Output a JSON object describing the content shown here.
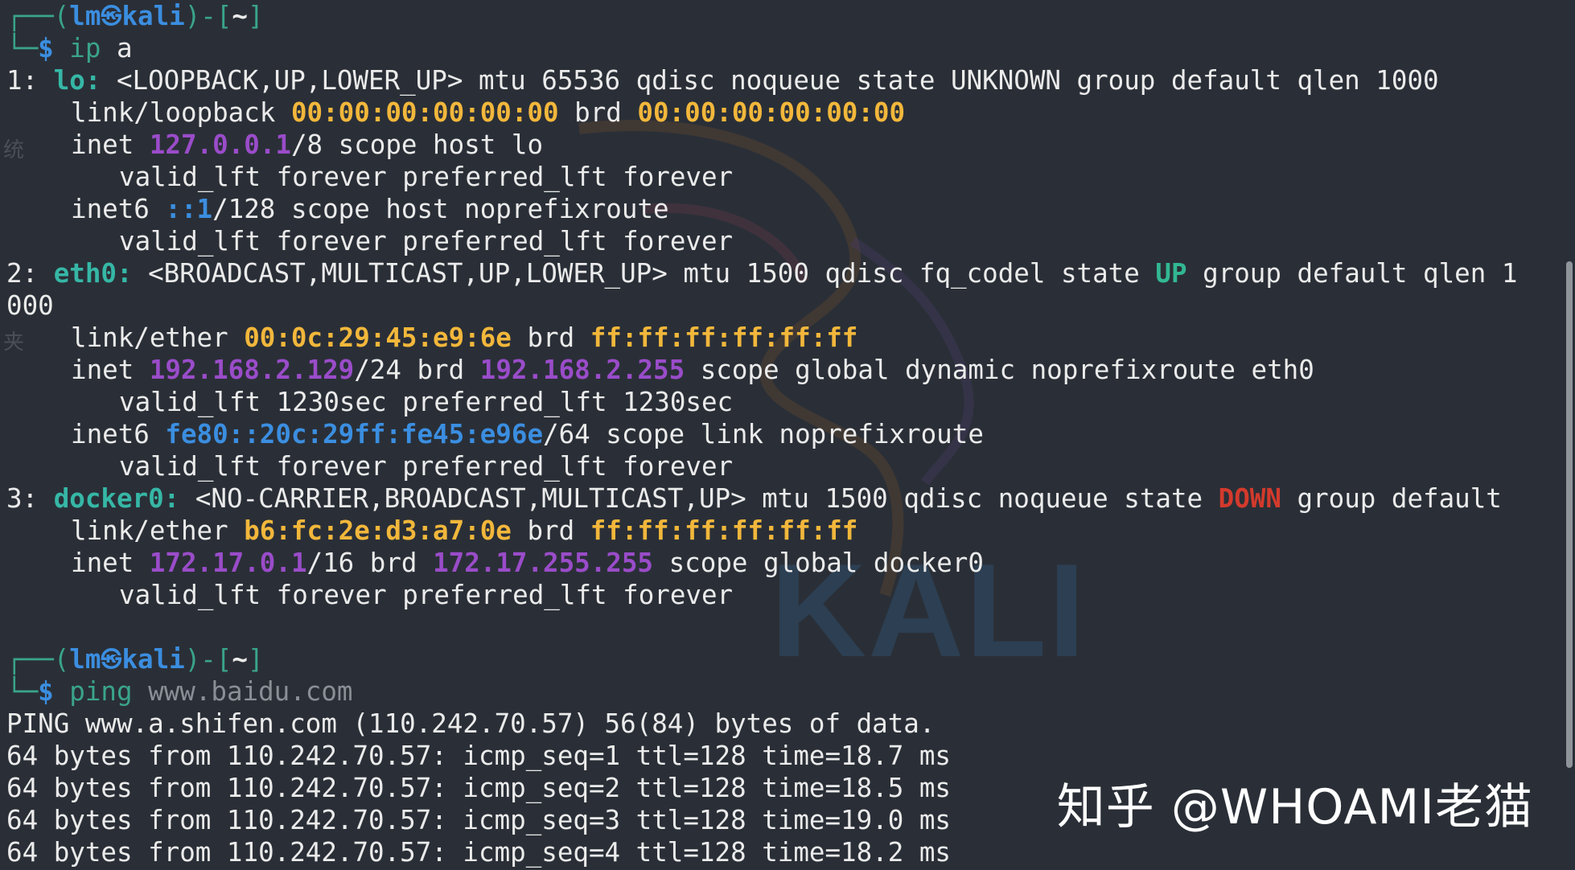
{
  "background_text": "KALI",
  "prompt1": {
    "corner_top": "┌──(",
    "user": "lm",
    "host": "kali",
    "mid": ")-[",
    "cwd": "~",
    "end": "]",
    "corner_bottom": "└─",
    "dollar": "$ ",
    "cmd": "ip",
    "args": " a"
  },
  "iface1": {
    "num": "1: ",
    "name": "lo:",
    "flags": " <LOOPBACK,UP,LOWER_UP> mtu 65536 qdisc noqueue state UNKNOWN group default qlen 1000",
    "link_label": "link/loopback ",
    "mac": "00:00:00:00:00:00",
    "brd_label": " brd ",
    "brd": "00:00:00:00:00:00",
    "inet_label": "inet ",
    "inet_ip": "127.0.0.1",
    "inet_rest": "/8 scope host lo",
    "valid1": "valid_lft forever preferred_lft forever",
    "inet6_label": "inet6 ",
    "inet6_ip": "::1",
    "inet6_rest": "/128 scope host noprefixroute",
    "valid2": "valid_lft forever preferred_lft forever"
  },
  "iface2": {
    "num": "2: ",
    "name": "eth0:",
    "flags": " <BROADCAST,MULTICAST,UP,LOWER_UP> mtu 1500 qdisc fq_codel state ",
    "state": "UP",
    "flags_tail": " group default qlen 1",
    "wrap": "000",
    "link_label": "link/ether ",
    "mac": "00:0c:29:45:e9:6e",
    "brd_label": " brd ",
    "brd": "ff:ff:ff:ff:ff:ff",
    "inet_label": "inet ",
    "inet_ip": "192.168.2.129",
    "inet_mid": "/24 brd ",
    "inet_brd": "192.168.2.255",
    "inet_rest": " scope global dynamic noprefixroute eth0",
    "valid1": "valid_lft 1230sec preferred_lft 1230sec",
    "inet6_label": "inet6 ",
    "inet6_ip": "fe80::20c:29ff:fe45:e96e",
    "inet6_rest": "/64 scope link noprefixroute",
    "valid2": "valid_lft forever preferred_lft forever"
  },
  "iface3": {
    "num": "3: ",
    "name": "docker0:",
    "flags": " <NO-CARRIER,BROADCAST,MULTICAST,UP> mtu 1500 qdisc noqueue state ",
    "state": "DOWN",
    "flags_tail": " group default",
    "link_label": "link/ether ",
    "mac": "b6:fc:2e:d3:a7:0e",
    "brd_label": " brd ",
    "brd": "ff:ff:ff:ff:ff:ff",
    "inet_label": "inet ",
    "inet_ip": "172.17.0.1",
    "inet_mid": "/16 brd ",
    "inet_brd": "172.17.255.255",
    "inet_rest": " scope global docker0",
    "valid1": "valid_lft forever preferred_lft forever"
  },
  "prompt2": {
    "corner_top": "┌──(",
    "user": "lm",
    "host": "kali",
    "mid": ")-[",
    "cwd": "~",
    "end": "]",
    "corner_bottom": "└─",
    "dollar": "$ ",
    "cmd": "ping",
    "args": " www.baidu.com"
  },
  "ping": {
    "header": "PING www.a.shifen.com (110.242.70.57) 56(84) bytes of data.",
    "replies": [
      "64 bytes from 110.242.70.57: icmp_seq=1 ttl=128 time=18.7 ms",
      "64 bytes from 110.242.70.57: icmp_seq=2 ttl=128 time=18.5 ms",
      "64 bytes from 110.242.70.57: icmp_seq=3 ttl=128 time=19.0 ms",
      "64 bytes from 110.242.70.57: icmp_seq=4 ttl=128 time=18.2 ms"
    ]
  },
  "side_chars": [
    "统",
    "夹"
  ],
  "watermark": "知乎 @WHOAMI老猫",
  "colors": {
    "background": "#2a2f37",
    "prompt_green": "#3aa48a",
    "host_blue": "#3b8ee0",
    "iface_cyan": "#36b7a6",
    "mac_yellow": "#f2b73b",
    "ip_purple": "#9a4cc9",
    "state_up": "#32b893",
    "state_down": "#d33a2c"
  }
}
